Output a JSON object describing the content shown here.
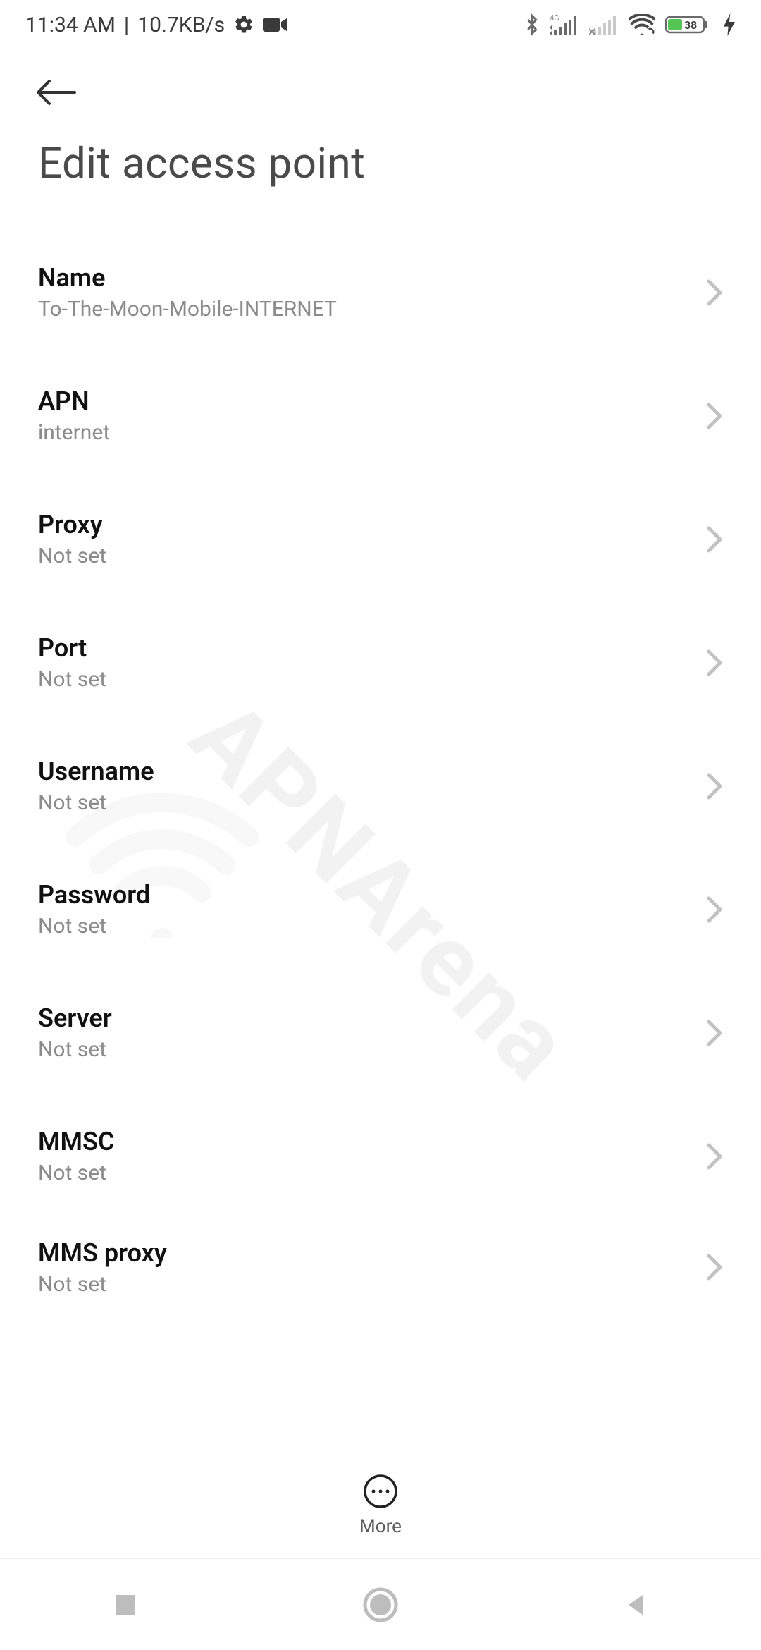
{
  "status_bar": {
    "time": "11:34 AM",
    "net_speed": "10.7KB/s",
    "battery_pct": "38"
  },
  "header": {
    "title": "Edit access point"
  },
  "rows": [
    {
      "label": "Name",
      "value": "To-The-Moon-Mobile-INTERNET"
    },
    {
      "label": "APN",
      "value": "internet"
    },
    {
      "label": "Proxy",
      "value": "Not set"
    },
    {
      "label": "Port",
      "value": "Not set"
    },
    {
      "label": "Username",
      "value": "Not set"
    },
    {
      "label": "Password",
      "value": "Not set"
    },
    {
      "label": "Server",
      "value": "Not set"
    },
    {
      "label": "MMSC",
      "value": "Not set"
    },
    {
      "label": "MMS proxy",
      "value": "Not set"
    }
  ],
  "bottom": {
    "more_label": "More"
  },
  "watermark": "APNArena"
}
